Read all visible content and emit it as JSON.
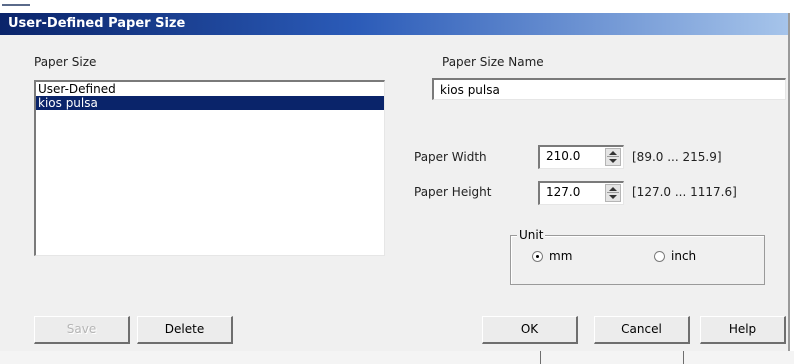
{
  "window": {
    "title": "User-Defined Paper Size"
  },
  "paper_size": {
    "label": "Paper Size",
    "items": [
      {
        "label": "User-Defined",
        "selected": false
      },
      {
        "label": "kios pulsa",
        "selected": true
      }
    ]
  },
  "paper_size_name": {
    "label": "Paper Size Name",
    "value": "kios pulsa"
  },
  "paper_width": {
    "label": "Paper Width",
    "value": "210.0",
    "range": "[89.0 ... 215.9]"
  },
  "paper_height": {
    "label": "Paper Height",
    "value": "127.0",
    "range": "[127.0 ... 1117.6]"
  },
  "unit": {
    "label": "Unit",
    "options": [
      {
        "label": "mm",
        "selected": true
      },
      {
        "label": "inch",
        "selected": false
      }
    ]
  },
  "buttons": {
    "save": "Save",
    "delete": "Delete",
    "ok": "OK",
    "cancel": "Cancel",
    "help": "Help"
  },
  "colors": {
    "title_start": "#0a246a",
    "title_end": "#a6c4ea",
    "selection": "#0a246a",
    "dialog_bg": "#f0f0f0"
  }
}
